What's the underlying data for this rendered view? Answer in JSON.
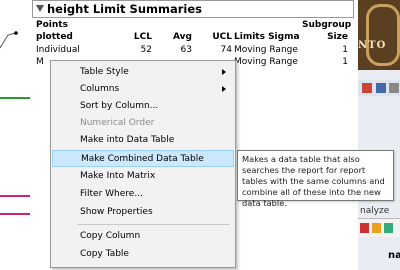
{
  "report": {
    "title": "height Limit Summaries",
    "columns": [
      "Points plotted",
      "LCL",
      "Avg",
      "UCL",
      "Limits Sigma",
      "Subgroup Size"
    ],
    "header": {
      "points_line1": "Points",
      "points_line2": "plotted",
      "lcl": "LCL",
      "avg": "Avg",
      "ucl": "UCL",
      "sigma": "Limits Sigma",
      "subgroup_line1": "Subgroup",
      "subgroup_line2": "Size"
    },
    "rows": [
      {
        "points": "Individual",
        "lcl": "52",
        "avg": "63",
        "ucl": "74",
        "sigma": "Moving Range",
        "size": "1"
      },
      {
        "points": "M",
        "lcl": "",
        "avg": "",
        "ucl": "",
        "sigma": "Moving Range",
        "size": "1"
      }
    ]
  },
  "context_menu": {
    "items": [
      {
        "label": "Table Style",
        "submenu": true
      },
      {
        "label": "Columns",
        "submenu": true
      },
      {
        "label": "Sort by Column..."
      },
      {
        "label": "Numerical Order",
        "disabled": true
      },
      {
        "label": "Make into Data Table"
      },
      {
        "label": "Make Combined Data Table",
        "highlighted": true
      },
      {
        "label": "Make Into Matrix"
      },
      {
        "label": "Filter Where..."
      },
      {
        "label": "Show Properties"
      },
      {
        "label": "Copy Column"
      },
      {
        "label": "Copy Table"
      }
    ]
  },
  "tooltip": {
    "text": "Makes a data table that also searches the report for report tables with the same columns and combine all of these into the new data table."
  },
  "right_panel": {
    "logo_text": "NTO",
    "analyze_partial": "nalyze",
    "bold_partial": "na"
  },
  "colors": {
    "highlight_bg": "#cce8ff",
    "highlight_border": "#99d1ff",
    "menu_bg": "#f2f2f2",
    "graph_line_green": "#2a9a2a",
    "graph_line_magenta": "#cc2277"
  }
}
